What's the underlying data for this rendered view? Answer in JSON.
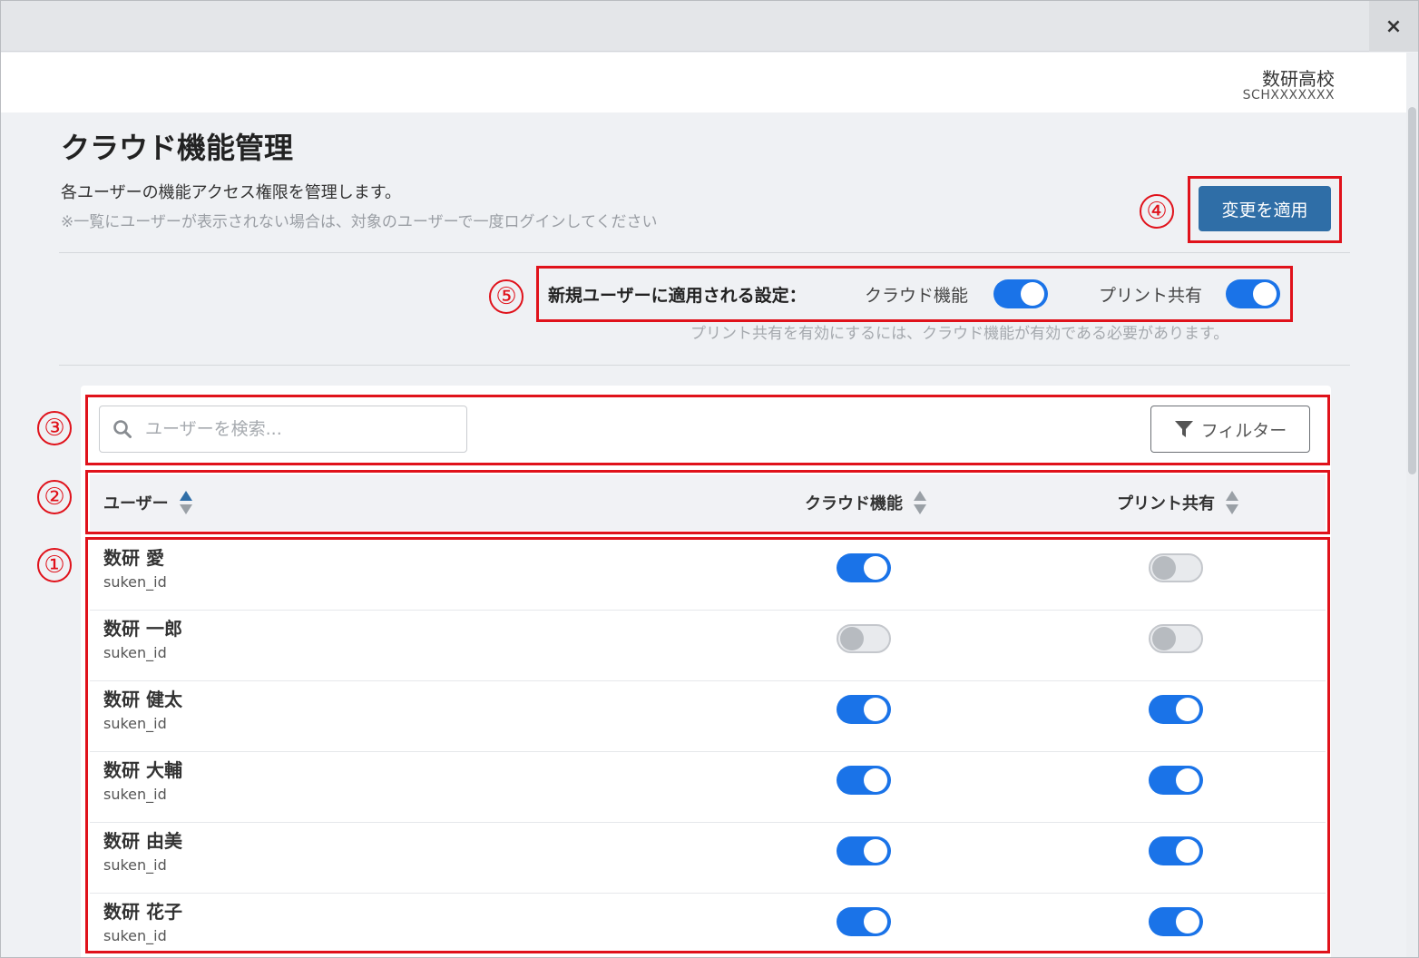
{
  "window": {
    "close_symbol": "×"
  },
  "school": {
    "name": "数研高校",
    "code": "SCHXXXXXXX"
  },
  "page": {
    "title": "クラウド機能管理",
    "description": "各ユーザーの機能アクセス権限を管理します。",
    "note": "※一覧にユーザーが表示されない場合は、対象のユーザーで一度ログインしてください"
  },
  "apply_button": {
    "label": "変更を適用"
  },
  "defaults": {
    "label": "新規ユーザーに適用される設定：",
    "cloud_label": "クラウド機能",
    "cloud_on": true,
    "print_label": "プリント共有",
    "print_on": true,
    "note": "プリント共有を有効にするには、クラウド機能が有効である必要があります。"
  },
  "search": {
    "placeholder": "ユーザーを検索..."
  },
  "filter_button": {
    "label": "フィルター",
    "icon": "filter-icon"
  },
  "table": {
    "headers": {
      "user": "ユーザー",
      "cloud": "クラウド機能",
      "print": "プリント共有"
    },
    "rows": [
      {
        "name": "数研 愛",
        "id": "suken_id",
        "cloud": true,
        "print": false
      },
      {
        "name": "数研 一郎",
        "id": "suken_id",
        "cloud": false,
        "print": false
      },
      {
        "name": "数研 健太",
        "id": "suken_id",
        "cloud": true,
        "print": true
      },
      {
        "name": "数研 大輔",
        "id": "suken_id",
        "cloud": true,
        "print": true
      },
      {
        "name": "数研 由美",
        "id": "suken_id",
        "cloud": true,
        "print": true
      },
      {
        "name": "数研 花子",
        "id": "suken_id",
        "cloud": true,
        "print": true
      }
    ]
  },
  "callouts": [
    "①",
    "②",
    "③",
    "④",
    "⑤"
  ],
  "colors": {
    "accent": "#1a73e8",
    "button": "#2f6ea7",
    "annotation": "#e0121b"
  }
}
